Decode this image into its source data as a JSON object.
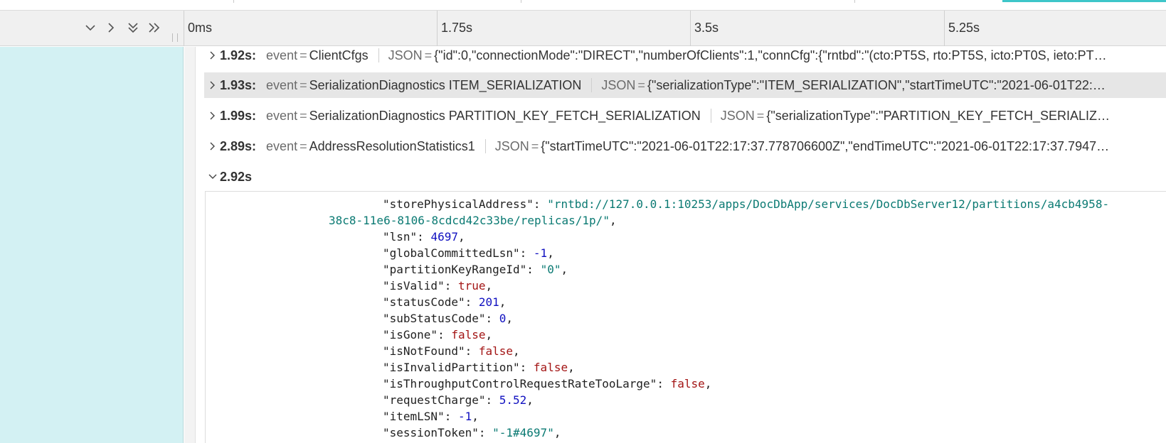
{
  "header": {
    "ticks": [
      "0ms",
      "1.75s",
      "3.5s",
      "5.25s"
    ]
  },
  "events": [
    {
      "time": "1.92s:",
      "key": "event",
      "value": "ClientCfgs",
      "json_key": "JSON",
      "json": "{\"id\":0,\"connectionMode\":\"DIRECT\",\"numberOfClients\":1,\"connCfg\":{\"rntbd\":\"(cto:PT5S, rto:PT5S, icto:PT0S, ieto:PT…"
    },
    {
      "time": "1.93s:",
      "key": "event",
      "value": "SerializationDiagnostics ITEM_SERIALIZATION",
      "json_key": "JSON",
      "json": "{\"serializationType\":\"ITEM_SERIALIZATION\",\"startTimeUTC\":\"2021-06-01T22:…"
    },
    {
      "time": "1.99s:",
      "key": "event",
      "value": "SerializationDiagnostics PARTITION_KEY_FETCH_SERIALIZATION",
      "json_key": "JSON",
      "json": "{\"serializationType\":\"PARTITION_KEY_FETCH_SERIALIZ…"
    },
    {
      "time": "2.89s:",
      "key": "event",
      "value": "AddressResolutionStatistics1",
      "json_key": "JSON",
      "json": "{\"startTimeUTC\":\"2021-06-01T22:17:37.778706600Z\",\"endTimeUTC\":\"2021-06-01T22:17:37.7947…"
    }
  ],
  "expanded": {
    "time": "2.92s"
  },
  "detail": {
    "lines": [
      {
        "key": "\"storePhysicalAddress\"",
        "value": "\"rntbd://127.0.0.1:10253/apps/DocDbApp/services/DocDbServer12/partitions/a4cb4958-",
        "type": "s"
      },
      {
        "cont": "38c8-11e6-8106-8cdcd42c33be/replicas/1p/\"",
        "type": "s"
      },
      {
        "key": "\"lsn\"",
        "value": "4697",
        "type": "n"
      },
      {
        "key": "\"globalCommittedLsn\"",
        "value": "-1",
        "type": "n"
      },
      {
        "key": "\"partitionKeyRangeId\"",
        "value": "\"0\"",
        "type": "s"
      },
      {
        "key": "\"isValid\"",
        "value": "true",
        "type": "b"
      },
      {
        "key": "\"statusCode\"",
        "value": "201",
        "type": "n"
      },
      {
        "key": "\"subStatusCode\"",
        "value": "0",
        "type": "n"
      },
      {
        "key": "\"isGone\"",
        "value": "false",
        "type": "b"
      },
      {
        "key": "\"isNotFound\"",
        "value": "false",
        "type": "b"
      },
      {
        "key": "\"isInvalidPartition\"",
        "value": "false",
        "type": "b"
      },
      {
        "key": "\"isThroughputControlRequestRateTooLarge\"",
        "value": "false",
        "type": "b"
      },
      {
        "key": "\"requestCharge\"",
        "value": "5.52",
        "type": "n"
      },
      {
        "key": "\"itemLSN\"",
        "value": "-1",
        "type": "n"
      },
      {
        "key": "\"sessionToken\"",
        "value": "\"-1#4697\"",
        "type": "s"
      }
    ]
  },
  "colors": {
    "left_panel": "#d3f1f3",
    "accent": "#3ec6c9",
    "json_string": "#0b7a73",
    "json_number": "#1010c0",
    "json_boolean": "#a31515"
  }
}
